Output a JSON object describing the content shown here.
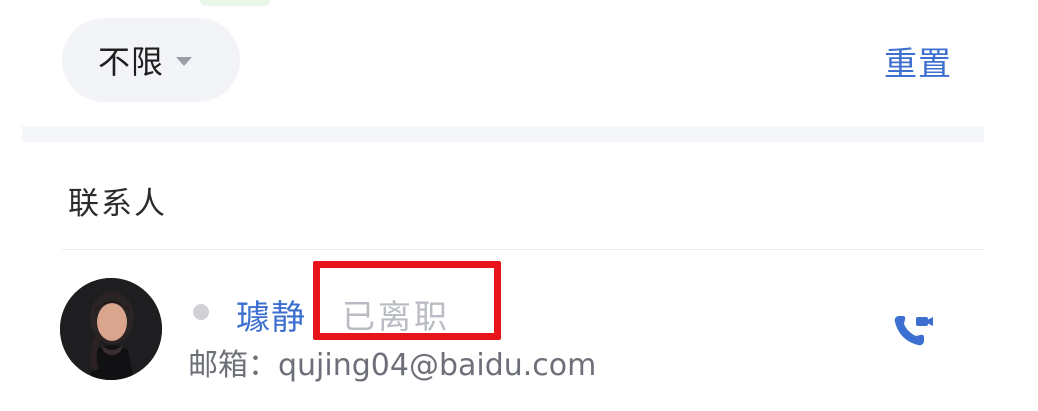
{
  "filter": {
    "selected_label": "不限",
    "reset_label": "重置"
  },
  "section": {
    "title": "联系人"
  },
  "contact": {
    "name": "璩静",
    "status": "已离职",
    "presence": "offline",
    "email_label": "邮箱：",
    "email": "qujing04@baidu.com",
    "call_icon": "video-call-icon",
    "avatar_icon": "avatar"
  },
  "colors": {
    "accent": "#3d6fd0",
    "highlight": "#e8141b",
    "muted": "#b9bcc3"
  }
}
